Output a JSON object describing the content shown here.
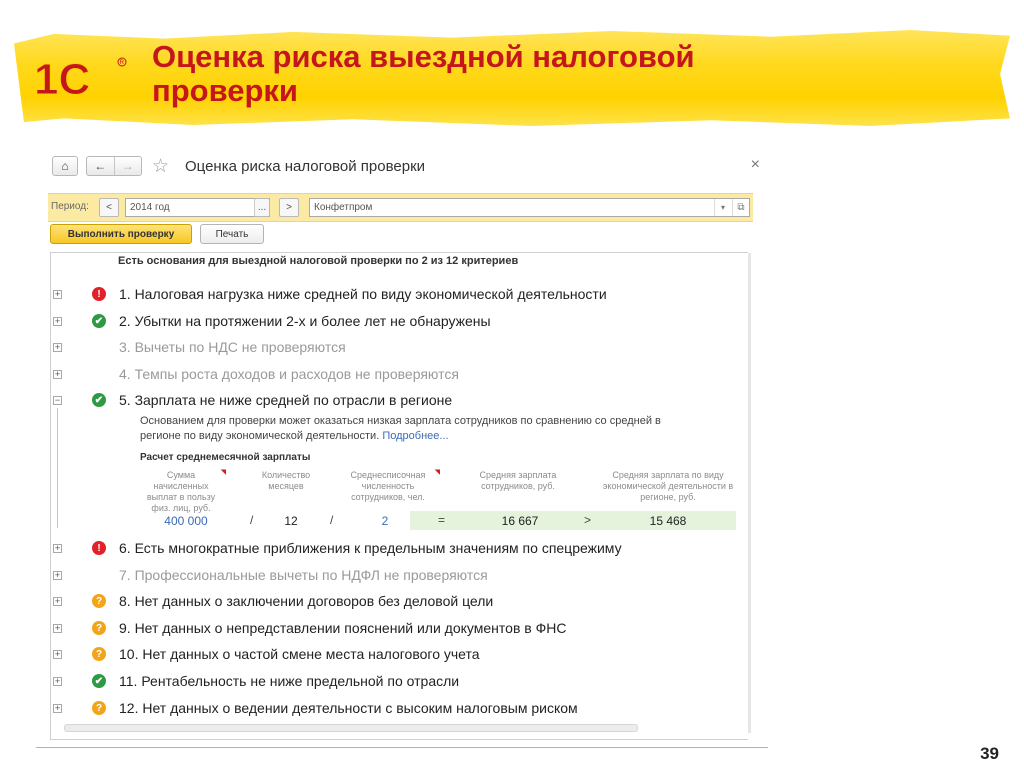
{
  "slide": {
    "title_line1": "Оценка риска выездной налоговой",
    "title_line2": "проверки",
    "page_number": "39",
    "logo_text": "1С"
  },
  "window": {
    "title": "Оценка риска налоговой проверки",
    "close": "×",
    "period_label": "Период:",
    "period_prev": "<",
    "period_value": "2014 год",
    "period_choose": "...",
    "period_next": ">",
    "organization": "Конфетпром",
    "run_button": "Выполнить проверку",
    "print_button": "Печать",
    "summary": "Есть основания для выездной налоговой проверки по 2 из 12 критериев"
  },
  "criteria": [
    {
      "expander": "+",
      "status": "bad",
      "icon": "!",
      "text": "1. Налоговая нагрузка ниже средней по виду экономической деятельности"
    },
    {
      "expander": "+",
      "status": "ok",
      "icon": "✔",
      "text": "2. Убытки на протяжении 2-х и более лет не обнаружены"
    },
    {
      "expander": "+",
      "status": "none",
      "icon": "",
      "text": "3. Вычеты по НДС не проверяются"
    },
    {
      "expander": "+",
      "status": "none",
      "icon": "",
      "text": "4. Темпы роста доходов и расходов не проверяются"
    },
    {
      "expander": "−",
      "status": "ok",
      "icon": "✔",
      "text": "5. Зарплата не ниже средней по отрасли в регионе"
    },
    {
      "expander": "+",
      "status": "bad",
      "icon": "!",
      "text": "6. Есть многократные приближения к предельным значениям по спецрежиму"
    },
    {
      "expander": "+",
      "status": "none",
      "icon": "",
      "text": "7. Профессиональные вычеты по НДФЛ не проверяются"
    },
    {
      "expander": "+",
      "status": "unknown",
      "icon": "?",
      "text": "8. Нет данных о заключении договоров без деловой цели"
    },
    {
      "expander": "+",
      "status": "unknown",
      "icon": "?",
      "text": "9. Нет данных о непредставлении пояснений или документов в ФНС"
    },
    {
      "expander": "+",
      "status": "unknown",
      "icon": "?",
      "text": "10. Нет данных о частой смене места налогового учета"
    },
    {
      "expander": "+",
      "status": "ok",
      "icon": "✔",
      "text": "11. Рентабельность не ниже предельной по отрасли"
    },
    {
      "expander": "+",
      "status": "unknown",
      "icon": "?",
      "text": "12. Нет данных о ведении деятельности с высоким налоговым риском"
    }
  ],
  "details": {
    "explanation": "Основанием для проверки может оказаться низкая зарплата сотрудников по сравнению со средней в регионе по виду экономической деятельности.",
    "more_link": "Подробнее...",
    "calc_title": "Расчет среднемесячной зарплаты",
    "columns": [
      "Сумма начисленных выплат в пользу физ. лиц, руб.",
      "Количество месяцев",
      "Среднесписочная численность сотрудников, чел.",
      "Средняя зарплата сотрудников, руб.",
      "Средняя зарплата по виду экономической деятельности в регионе, руб."
    ],
    "values": {
      "total_pay": "400 000",
      "op1": "/",
      "months": "12",
      "op2": "/",
      "headcount": "2",
      "op3": "=",
      "avg_salary": "16 667",
      "op4": ">",
      "region_avg": "15 468"
    }
  },
  "colors": {
    "accent_yellow": "#ffd200",
    "title_red": "#c4161c",
    "status_bad": "#e2222b",
    "status_ok": "#2f9a44",
    "status_unknown": "#f3a51a"
  }
}
